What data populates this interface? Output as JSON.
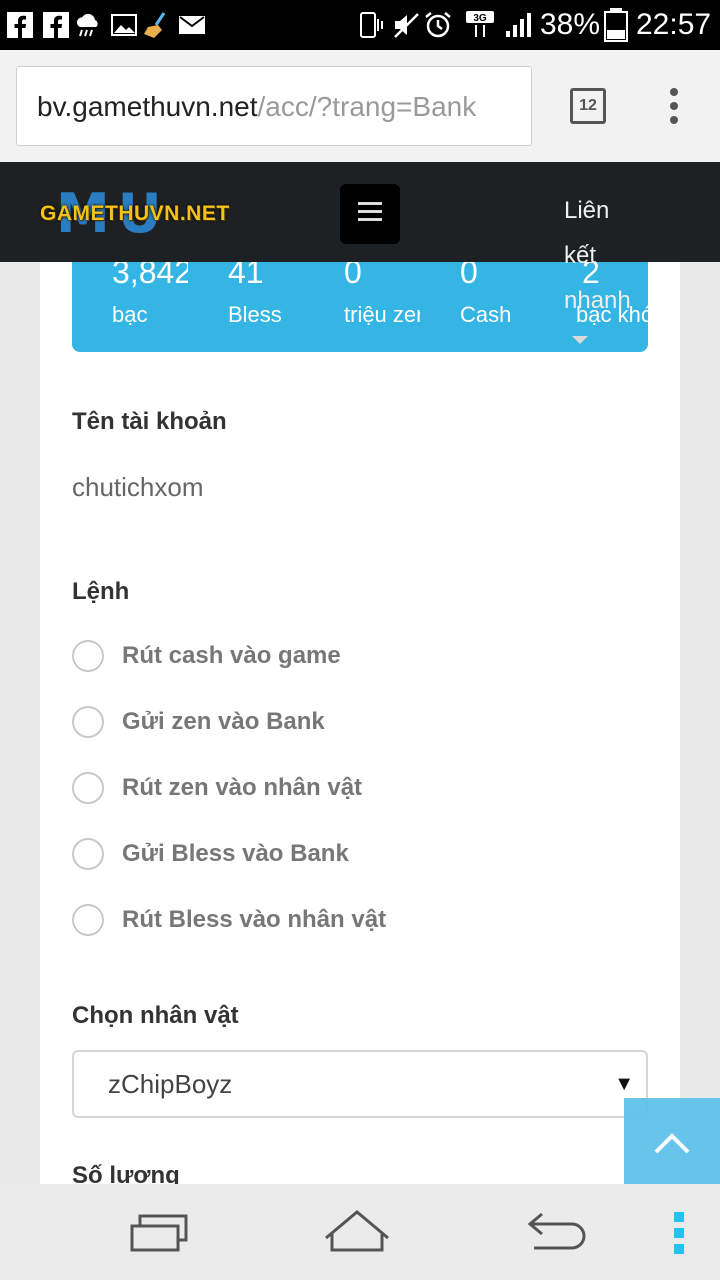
{
  "status_bar": {
    "battery": "38%",
    "time": "22:57",
    "network": "3G"
  },
  "browser": {
    "url_domain": "bv.gamethuvn.net",
    "url_path": "/acc/?trang=Bank",
    "tab_count": "12"
  },
  "header": {
    "logo_text": "GAMETHUVN.NET",
    "logo_mu": "MU",
    "quick_link": "Liên kết nhanh"
  },
  "stats": [
    {
      "value": "3,842",
      "label": "bạc"
    },
    {
      "value": "41",
      "label": "Bless"
    },
    {
      "value": "0",
      "label": "triệu zen"
    },
    {
      "value": "0",
      "label": "Cash"
    },
    {
      "value": "2",
      "label": "bạc khóa"
    }
  ],
  "form": {
    "account_label": "Tên tài khoản",
    "account_value": "chutichxom",
    "command_label": "Lệnh",
    "commands": [
      "Rút cash vào game",
      "Gửi zen vào Bank",
      "Rút zen vào nhân vật",
      "Gửi Bless vào Bank",
      "Rút Bless vào nhân vật"
    ],
    "character_label": "Chọn nhân vật",
    "character_value": "zChipBoyz",
    "quantity_label": "Số lượng"
  },
  "colors": {
    "stats_bg": "#35b5e3",
    "header_bg": "#1e2124",
    "logo_gold": "#f2c21b",
    "nav_accent": "#20c4ef"
  }
}
